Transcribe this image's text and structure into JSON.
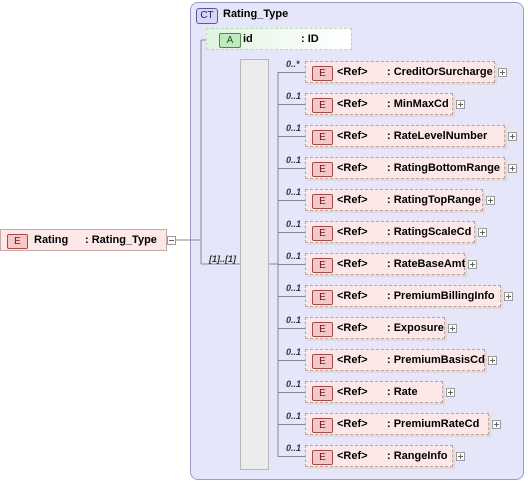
{
  "root": {
    "badge": "E",
    "name": "Rating",
    "type": ": Rating_Type"
  },
  "complex_type": {
    "badge": "CT",
    "name": "Rating_Type"
  },
  "attribute": {
    "badge": "A",
    "name": "id",
    "type": ": ID"
  },
  "sequence": {
    "multiplicity": "[1]..[1]"
  },
  "children": [
    {
      "badge": "E",
      "ref": "<Ref>",
      "name": ": CreditOrSurcharge",
      "mult": "0..*"
    },
    {
      "badge": "E",
      "ref": "<Ref>",
      "name": ": MinMaxCd",
      "mult": "0..1"
    },
    {
      "badge": "E",
      "ref": "<Ref>",
      "name": ": RateLevelNumber",
      "mult": "0..1"
    },
    {
      "badge": "E",
      "ref": "<Ref>",
      "name": ": RatingBottomRange",
      "mult": "0..1"
    },
    {
      "badge": "E",
      "ref": "<Ref>",
      "name": ": RatingTopRange",
      "mult": "0..1"
    },
    {
      "badge": "E",
      "ref": "<Ref>",
      "name": ": RatingScaleCd",
      "mult": "0..1"
    },
    {
      "badge": "E",
      "ref": "<Ref>",
      "name": ": RateBaseAmt",
      "mult": "0..1"
    },
    {
      "badge": "E",
      "ref": "<Ref>",
      "name": ": PremiumBillingInfo",
      "mult": "0..1"
    },
    {
      "badge": "E",
      "ref": "<Ref>",
      "name": ": Exposure",
      "mult": "0..1"
    },
    {
      "badge": "E",
      "ref": "<Ref>",
      "name": ": PremiumBasisCd",
      "mult": "0..1"
    },
    {
      "badge": "E",
      "ref": "<Ref>",
      "name": ": Rate",
      "mult": "0..1"
    },
    {
      "badge": "E",
      "ref": "<Ref>",
      "name": ": PremiumRateCd",
      "mult": "0..1"
    },
    {
      "badge": "E",
      "ref": "<Ref>",
      "name": ": RangeInfo",
      "mult": "0..1"
    }
  ]
}
